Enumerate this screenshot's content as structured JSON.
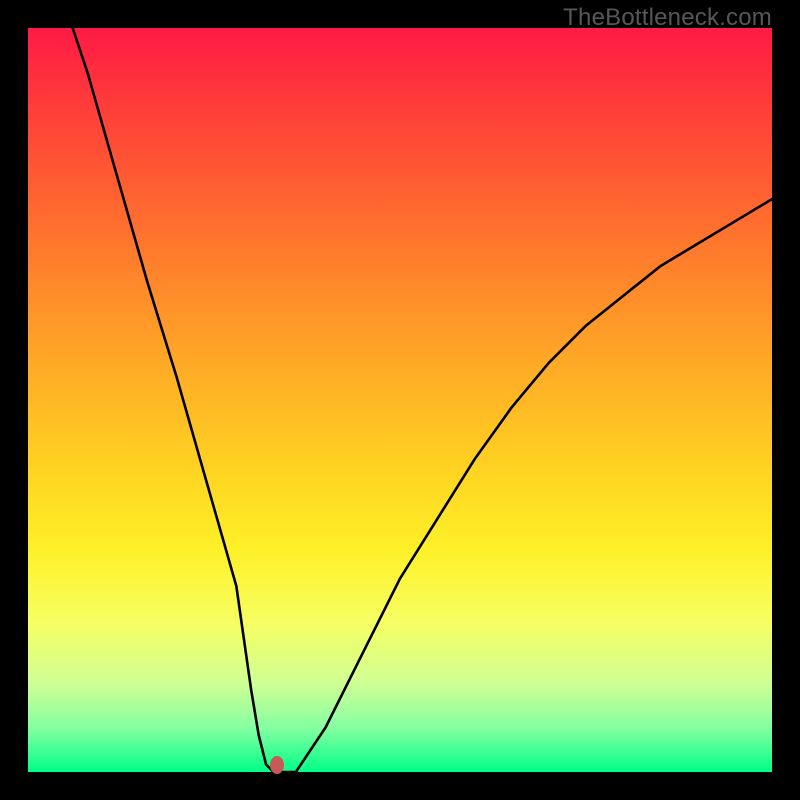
{
  "watermark": "TheBottleneck.com",
  "chart_data": {
    "type": "line",
    "title": "",
    "xlabel": "",
    "ylabel": "",
    "xlim": [
      0,
      100
    ],
    "ylim": [
      0,
      100
    ],
    "grid": false,
    "legend": false,
    "series": [
      {
        "name": "bottleneck-curve",
        "x": [
          6,
          8,
          12,
          16,
          20,
          24,
          28,
          30,
          31,
          32,
          33,
          34,
          36,
          40,
          45,
          50,
          55,
          60,
          65,
          70,
          75,
          80,
          85,
          90,
          95,
          100
        ],
        "y": [
          100,
          94,
          80,
          66,
          53,
          39,
          25,
          11,
          5,
          1,
          0,
          0,
          0,
          6,
          16,
          26,
          34,
          42,
          49,
          55,
          60,
          64,
          68,
          71,
          74,
          77
        ]
      }
    ],
    "marker": {
      "x": 33.5,
      "y": 1.0,
      "color": "#c75a56"
    },
    "background_gradient": {
      "type": "vertical",
      "stops": [
        {
          "pos": 0,
          "color": "#ff1a44"
        },
        {
          "pos": 50,
          "color": "#ffb824"
        },
        {
          "pos": 80,
          "color": "#f6ff63"
        },
        {
          "pos": 100,
          "color": "#00ff87"
        }
      ]
    }
  }
}
